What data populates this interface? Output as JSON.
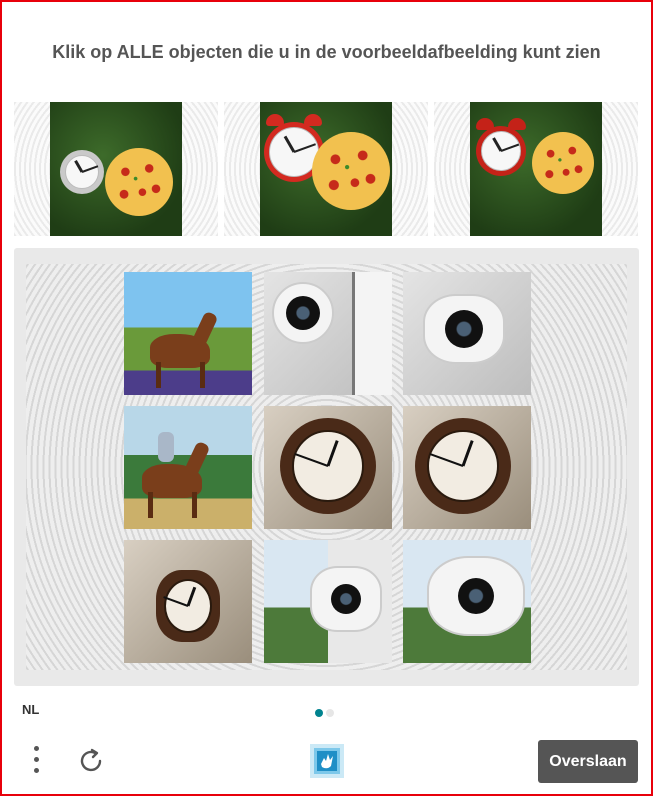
{
  "prompt": "Klik op ALLE objecten die u in de voorbeeldafbeelding kunt zien",
  "example_images": [
    {
      "id": "example-1",
      "content": "clock-and-pizza"
    },
    {
      "id": "example-2",
      "content": "clock-and-pizza"
    },
    {
      "id": "example-3",
      "content": "clock-and-pizza"
    }
  ],
  "grid_tiles": [
    {
      "row": 1,
      "col": 1,
      "content": "horse"
    },
    {
      "row": 1,
      "col": 2,
      "content": "security-camera"
    },
    {
      "row": 1,
      "col": 3,
      "content": "security-camera"
    },
    {
      "row": 2,
      "col": 1,
      "content": "horse-with-rider"
    },
    {
      "row": 2,
      "col": 2,
      "content": "clock"
    },
    {
      "row": 2,
      "col": 3,
      "content": "clock"
    },
    {
      "row": 3,
      "col": 1,
      "content": "clock"
    },
    {
      "row": 3,
      "col": 2,
      "content": "security-camera"
    },
    {
      "row": 3,
      "col": 3,
      "content": "security-camera"
    }
  ],
  "footer": {
    "language": "NL",
    "pages": {
      "count": 2,
      "active": 1
    },
    "skip_label": "Overslaan"
  },
  "icons": {
    "menu": "vertical-dots-icon",
    "refresh": "refresh-icon",
    "logo": "hand-logo-icon"
  },
  "colors": {
    "frame_border": "#e8000b",
    "skip_button": "#555555",
    "dot_active": "#00838f",
    "dot_inactive": "#e6e6e6",
    "logo_blue": "#2fa8dd"
  }
}
